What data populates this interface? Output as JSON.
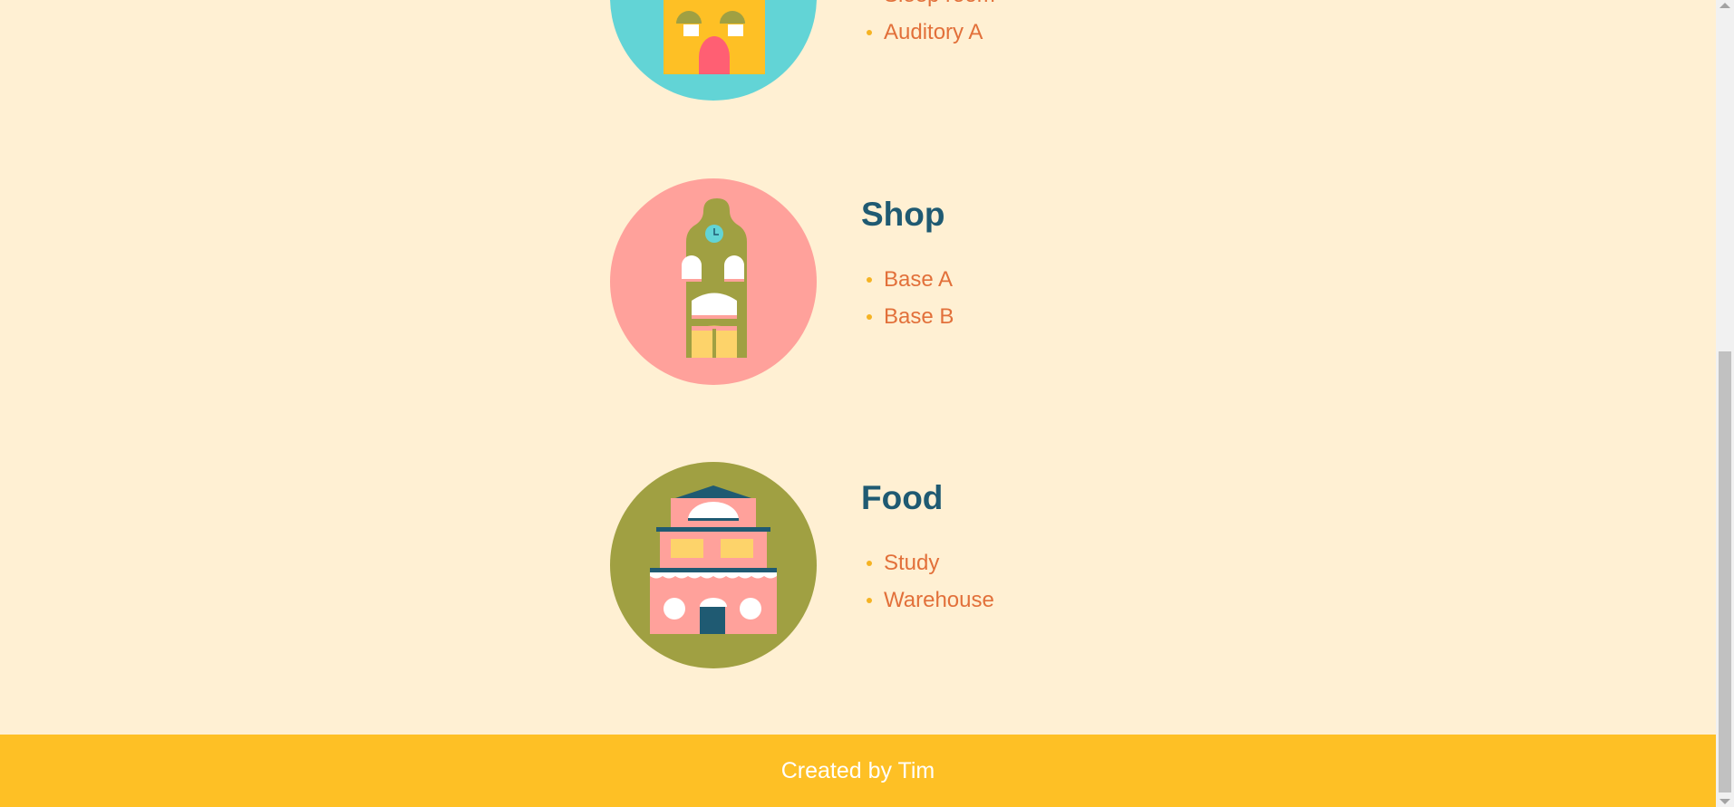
{
  "sections": [
    {
      "title": "",
      "items": [
        "Sleep room",
        "Auditory A"
      ],
      "circle_color": "#62d4d6",
      "icon": "yellow-building-icon"
    },
    {
      "title": "Shop",
      "items": [
        "Base A",
        "Base B"
      ],
      "circle_color": "#ffa19b",
      "icon": "clock-tower-building-icon"
    },
    {
      "title": "Food",
      "items": [
        "Study",
        "Warehouse"
      ],
      "circle_color": "#a0a042",
      "icon": "pink-building-icon"
    }
  ],
  "footer": {
    "text": "Created by Tim"
  },
  "colors": {
    "background": "#fff0d3",
    "title": "#1f5a72",
    "item": "#e2703a",
    "bullet": "#f5b322",
    "footer": "#fec025"
  }
}
